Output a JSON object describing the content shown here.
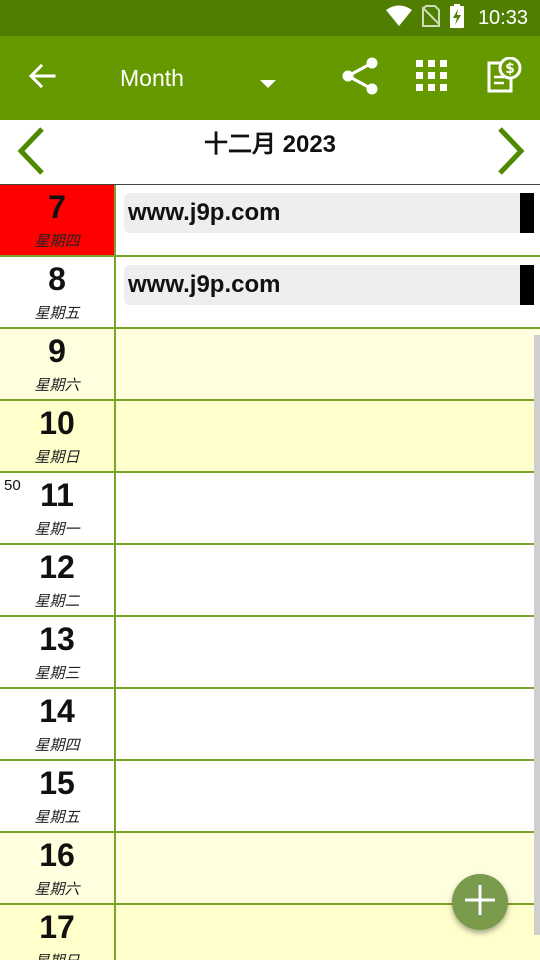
{
  "status_bar": {
    "time": "10:33",
    "icons": [
      "wifi-icon",
      "no-sim-icon",
      "battery-charging-icon"
    ]
  },
  "app_bar": {
    "back_icon": "arrow-back-icon",
    "view_label": "Month",
    "view_dropdown_icon": "dropdown-arrow-icon",
    "actions": [
      "share-icon",
      "grid-apps-icon",
      "receipt-dollar-icon"
    ]
  },
  "month_header": {
    "title": "十二月 2023",
    "prev_icon": "chevron-left-icon",
    "next_icon": "chevron-right-icon"
  },
  "days": [
    {
      "day": "7",
      "weekday": "星期四",
      "week_number": "",
      "bg": "#ff0000",
      "events": [
        "www.j9p.com"
      ]
    },
    {
      "day": "8",
      "weekday": "星期五",
      "week_number": "",
      "bg": "#ffffff",
      "events": [
        "www.j9p.com"
      ]
    },
    {
      "day": "9",
      "weekday": "星期六",
      "week_number": "",
      "bg": "#ffffe0",
      "events": []
    },
    {
      "day": "10",
      "weekday": "星期日",
      "week_number": "",
      "bg": "#ffffcc",
      "events": []
    },
    {
      "day": "11",
      "weekday": "星期一",
      "week_number": "50",
      "bg": "#ffffff",
      "events": []
    },
    {
      "day": "12",
      "weekday": "星期二",
      "week_number": "",
      "bg": "#ffffff",
      "events": []
    },
    {
      "day": "13",
      "weekday": "星期三",
      "week_number": "",
      "bg": "#ffffff",
      "events": []
    },
    {
      "day": "14",
      "weekday": "星期四",
      "week_number": "",
      "bg": "#ffffff",
      "events": []
    },
    {
      "day": "15",
      "weekday": "星期五",
      "week_number": "",
      "bg": "#ffffff",
      "events": []
    },
    {
      "day": "16",
      "weekday": "星期六",
      "week_number": "",
      "bg": "#ffffe0",
      "events": []
    },
    {
      "day": "17",
      "weekday": "星期日",
      "week_number": "",
      "bg": "#ffffcc",
      "events": []
    }
  ],
  "fab": {
    "icon": "plus-icon"
  },
  "colors": {
    "status_bar": "#507e00",
    "app_bar": "#669900",
    "divider": "#7aa52a",
    "today": "#ff0000",
    "event_bar": "#000000",
    "event_bg": "#eeeeee"
  }
}
